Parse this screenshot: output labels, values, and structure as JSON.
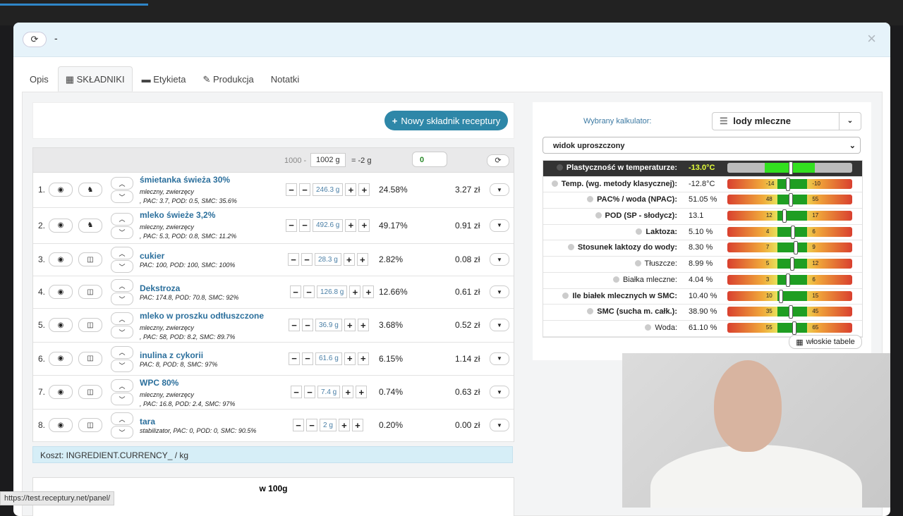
{
  "modal": {
    "title": "-",
    "refresh_icon": "refresh-icon",
    "close": "×"
  },
  "tabs": [
    {
      "label": "Opis",
      "icon": ""
    },
    {
      "label": "SKŁADNIKI",
      "icon": "calculator-icon"
    },
    {
      "label": "Etykieta",
      "icon": "id-card-icon"
    },
    {
      "label": "Produkcja",
      "icon": "wrench-icon"
    },
    {
      "label": "Notatki",
      "icon": ""
    }
  ],
  "new_ingredient_label": "Nowy składnik receptury",
  "table_header": {
    "total_prefix": "1000 -",
    "total_value": "1002 g",
    "diff": "= -2 g",
    "zero_value": "0"
  },
  "ingredients": [
    {
      "num": "1.",
      "name": "śmietanka świeża 30%",
      "desc1": "mleczny, zwierzęcy",
      "desc2": ", PAC: 3.7, POD: 0.5, SMC: 35.6%",
      "qty": "246.3 g",
      "pct": "24.58%",
      "price": "3.27 zł",
      "icon": "cow-icon"
    },
    {
      "num": "2.",
      "name": "mleko świeże 3,2%",
      "desc1": "mleczny, zwierzęcy",
      "desc2": ", PAC: 5.3, POD: 0.8, SMC: 11.2%",
      "qty": "492.6 g",
      "pct": "49.17%",
      "price": "0.91 zł",
      "icon": "cow-icon"
    },
    {
      "num": "3.",
      "name": "cukier",
      "desc1": "PAC: 100, POD: 100, SMC: 100%",
      "desc2": "",
      "qty": "28.3 g",
      "pct": "2.82%",
      "price": "0.08 zł",
      "icon": "bowl-icon"
    },
    {
      "num": "4.",
      "name": "Dekstroza",
      "desc1": "PAC: 174.8, POD: 70.8, SMC: 92%",
      "desc2": "",
      "qty": "126.8 g",
      "pct": "12.66%",
      "price": "0.61 zł",
      "icon": "bowl-icon"
    },
    {
      "num": "5.",
      "name": "mleko w proszku odtłuszczone",
      "desc1": "mleczny, zwierzęcy",
      "desc2": ", PAC: 58, POD: 8.2, SMC: 89.7%",
      "qty": "36.9 g",
      "pct": "3.68%",
      "price": "0.52 zł",
      "icon": "bowl-icon"
    },
    {
      "num": "6.",
      "name": "inulina z cykorii",
      "desc1": "PAC: 8, POD: 8, SMC: 97%",
      "desc2": "",
      "qty": "61.6 g",
      "pct": "6.15%",
      "price": "1.14 zł",
      "icon": "bowl-icon"
    },
    {
      "num": "7.",
      "name": "WPC 80%",
      "desc1": "mleczny, zwierzęcy",
      "desc2": ", PAC: 16.8, POD: 2.4, SMC: 97%",
      "qty": "7.4 g",
      "pct": "0.74%",
      "price": "0.63 zł",
      "icon": "bowl-icon"
    },
    {
      "num": "8.",
      "name": "tara",
      "desc1": "stabilizator, PAC: 0, POD: 0, SMC: 90.5%",
      "desc2": "",
      "qty": "2 g",
      "pct": "0.20%",
      "price": "0.00 zł",
      "icon": "bowl-icon"
    }
  ],
  "cost_label": "Koszt: INGREDIENT.CURRENCY_ / kg",
  "w100_label": "w 100g",
  "calculator": {
    "label": "Wybrany kalkulator:",
    "value": "lody mleczne",
    "view": "widok uproszczony"
  },
  "params": [
    {
      "label": "Plastyczność w temperaturze:",
      "value": "-13.0°C",
      "bold": true,
      "header": true
    },
    {
      "label": "Temp. (wg. metody klasycznej):",
      "value": "-12.8°C",
      "bold": true,
      "lo": "-14",
      "hi": "-10",
      "level": 0.47
    },
    {
      "label": "PAC% / woda (NPAC):",
      "value": "51.05 %",
      "bold": true,
      "lo": "48",
      "hi": "55",
      "level": 0.49
    },
    {
      "label": "POD (SP - słodycz):",
      "value": "13.1",
      "bold": true,
      "lo": "12",
      "hi": "17",
      "level": 0.44
    },
    {
      "label": "Laktoza:",
      "value": "5.10 %",
      "bold": true,
      "lo": "4",
      "hi": "6",
      "level": 0.51
    },
    {
      "label": "Stosunek laktozy do wody:",
      "value": "8.30 %",
      "bold": true,
      "lo": "7",
      "hi": "9",
      "level": 0.53
    },
    {
      "label": "Tłuszcze:",
      "value": "8.99 %",
      "bold": false,
      "lo": "5",
      "hi": "12",
      "level": 0.5
    },
    {
      "label": "Białka mleczne:",
      "value": "4.04 %",
      "bold": false,
      "lo": "3",
      "hi": "6",
      "level": 0.47
    },
    {
      "label": "Ile białek mlecznych w SMC:",
      "value": "10.40 %",
      "bold": true,
      "lo": "10",
      "hi": "15",
      "level": 0.41
    },
    {
      "label": "SMC (sucha m. całk.):",
      "value": "38.90 %",
      "bold": true,
      "lo": "35",
      "hi": "45",
      "level": 0.49
    },
    {
      "label": "Woda:",
      "value": "61.10 %",
      "bold": false,
      "lo": "55",
      "hi": "65",
      "level": 0.52
    }
  ],
  "italian_tables_label": "włoskie tabele",
  "status_url": "https://test.receptury.net/panel/"
}
